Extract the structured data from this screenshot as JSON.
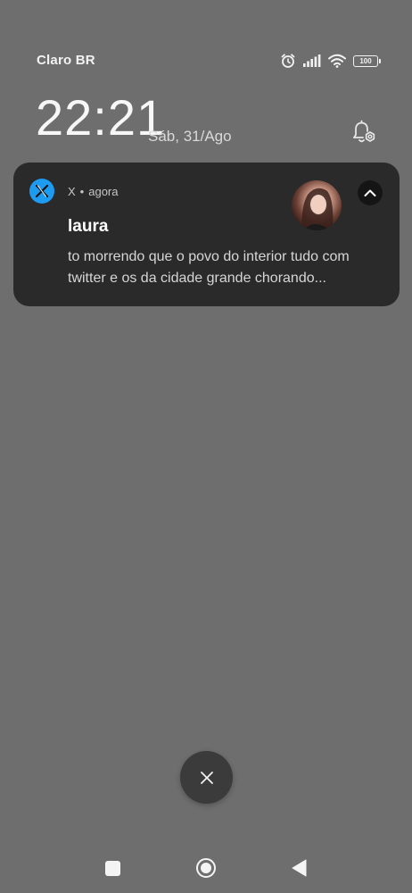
{
  "status_bar": {
    "carrier": "Claro BR",
    "battery_level": "100",
    "icons": [
      "alarm-icon",
      "signal-icon",
      "wifi-icon",
      "battery-icon"
    ]
  },
  "lockscreen": {
    "time": "22:21",
    "date": "Sáb, 31/Ago",
    "settings_icon": "notification-settings-icon"
  },
  "notification": {
    "app_name": "X",
    "separator": "•",
    "time_ago": "agora",
    "sender": "laura",
    "message": "to morrendo que o povo do interior tudo com twitter e os da cidade grande chorando...",
    "app_icon_color": "#1d9bf0",
    "card_color": "#2a2a2a"
  },
  "actions": {
    "clear_icon": "close-icon"
  },
  "nav_bar": {
    "icons": [
      "recents-icon",
      "home-icon",
      "back-icon"
    ]
  },
  "colors": {
    "background": "#6e6e6e",
    "accent": "#1d9bf0"
  }
}
